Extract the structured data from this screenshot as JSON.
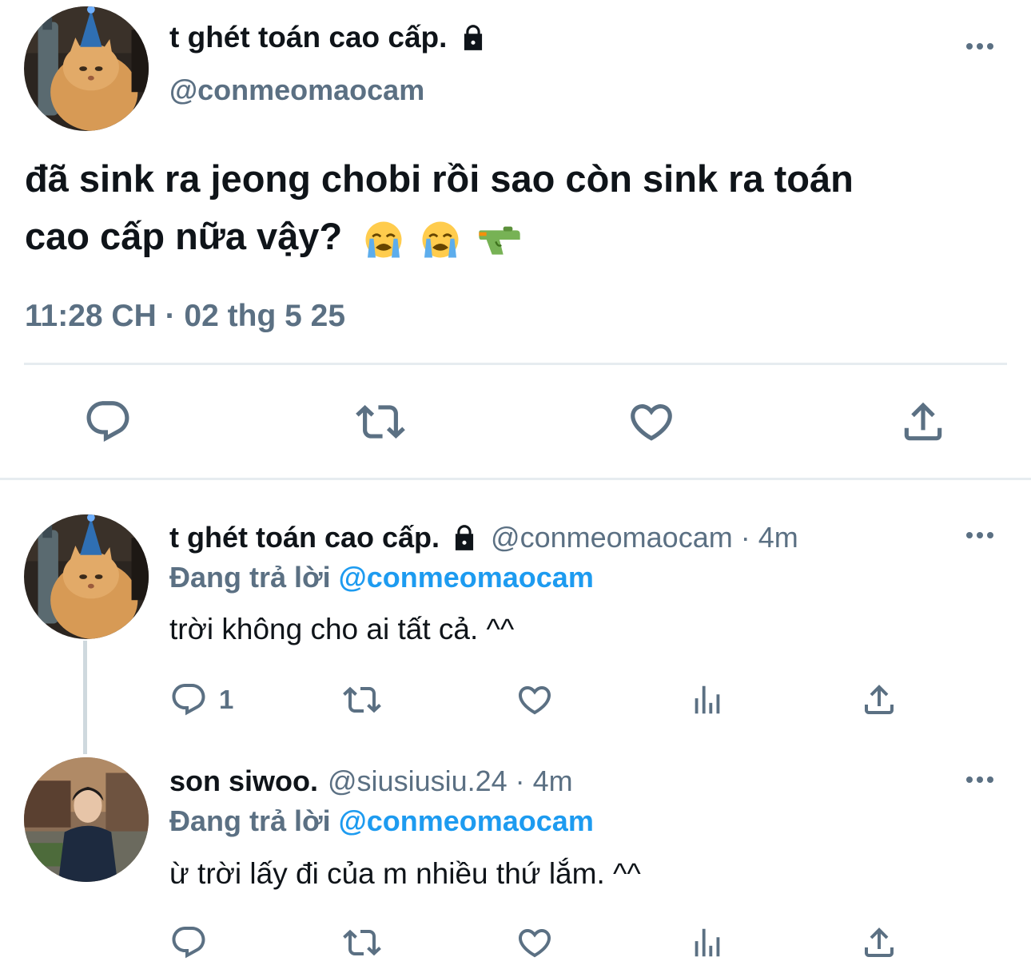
{
  "main_tweet": {
    "display_name": "t ghét toán cao cấp.",
    "avatar_icon": "cat-party-hat-avatar",
    "locked_icon": "lock-icon",
    "handle": "@conmeomaocam",
    "text_line1": "đã sink ra jeong chobi rồi sao còn sink ra toán",
    "text_line2": "cao cấp nữa vậy?",
    "emojis": [
      "loudly-crying-face-emoji",
      "loudly-crying-face-emoji",
      "water-pistol-emoji"
    ],
    "timestamp": "11:28 CH · 02 thg 5 25",
    "actions": [
      "reply-icon",
      "retweet-icon",
      "like-icon",
      "share-icon"
    ]
  },
  "replies": [
    {
      "display_name": "t ghét toán cao cấp.",
      "handle": "@conmeomaocam · 4m",
      "replying_prefix": "Đang trả lời",
      "replying_to": "@conmeomaocam",
      "text": "trời không cho ai tất cả. ^^",
      "reply_count": "1",
      "avatar_icon": "cat-party-hat-avatar"
    },
    {
      "display_name": "son siwoo.",
      "handle": "@siusiusiu.24 · 4m",
      "replying_prefix": "Đang trả lời",
      "replying_to": "@conmeomaocam",
      "text": "ừ trời lấy đi của m nhiều thứ lắm. ^^",
      "reply_count": "",
      "avatar_icon": "person-street-avatar"
    }
  ],
  "colors": {
    "text": "#0f1419",
    "secondary": "#5b7083",
    "accent": "#1d9bf0",
    "divider": "#e6ecf0"
  }
}
